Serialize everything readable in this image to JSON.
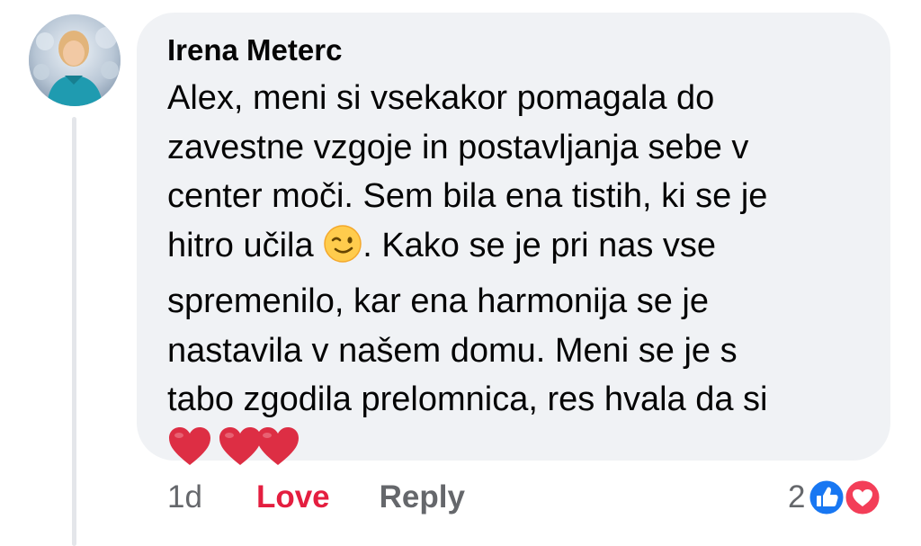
{
  "comment": {
    "author": "Irena Meterc",
    "avatar_icon": "user-avatar-photo",
    "lines": [
      "Alex, meni si vsekakor pomagala do",
      "zavestne vzgoje in postavljanja sebe v",
      "center moči. Sem bila ena tistih, ki se je",
      "hitro učila",
      ". Kako se je pri nas vse",
      "spremenilo, kar ena harmonija se je",
      "nastavila v našem domu.  Meni se je s",
      "tabo zgodila prelomnica, res hvala da si"
    ],
    "emojis": {
      "wink": "winking-face-emoji",
      "heart": "red-heart-emoji"
    }
  },
  "actions": {
    "time": "1d",
    "love_label": "Love",
    "reply_label": "Reply"
  },
  "reactions": {
    "count": "2",
    "types": [
      "like-reaction-icon",
      "love-reaction-icon"
    ]
  },
  "colors": {
    "bubble_bg": "#f0f2f5",
    "love_red": "#e41e3f",
    "like_blue": "#1877f2",
    "muted_text": "#65676b"
  }
}
